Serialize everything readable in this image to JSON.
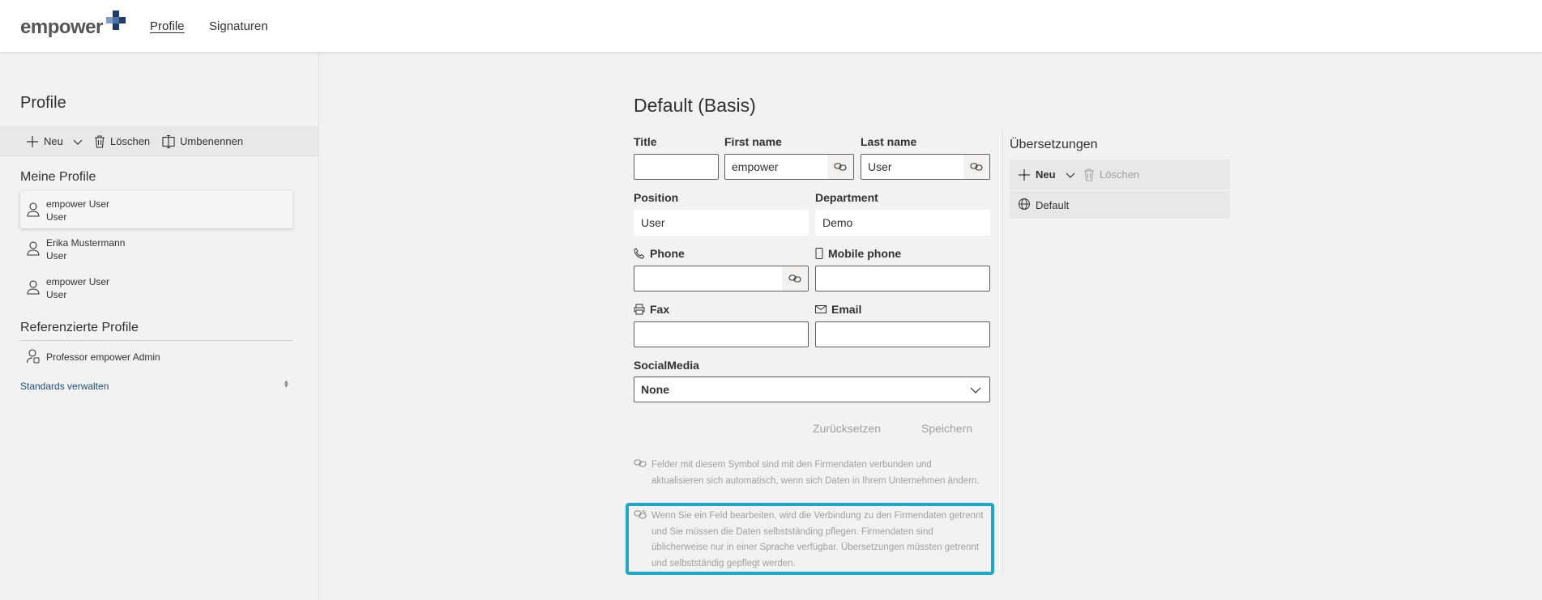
{
  "header": {
    "logo_text": "empower",
    "nav": [
      "Profile",
      "Signaturen"
    ]
  },
  "sidebar": {
    "title": "Profile",
    "toolbar": {
      "new_label": "Neu",
      "delete_label": "Löschen",
      "rename_label": "Umbenennen"
    },
    "my_profiles_title": "Meine Profile",
    "my_profiles": [
      {
        "name": "empower User",
        "role": "User",
        "selected": true
      },
      {
        "name": "Erika Mustermann",
        "role": "User",
        "selected": false
      },
      {
        "name": "empower User",
        "role": "User",
        "selected": false
      }
    ],
    "referenced_title": "Referenzierte Profile",
    "referenced": [
      {
        "name": "Professor empower Admin"
      }
    ],
    "standards_link": "Standards verwalten"
  },
  "form": {
    "title": "Default (Basis)",
    "fields": {
      "title": {
        "label": "Title",
        "value": ""
      },
      "first_name": {
        "label": "First name",
        "value": "empower"
      },
      "last_name": {
        "label": "Last name",
        "value": "User"
      },
      "position": {
        "label": "Position",
        "value": "User"
      },
      "department": {
        "label": "Department",
        "value": "Demo"
      },
      "phone": {
        "label": "Phone",
        "value": ""
      },
      "mobile": {
        "label": "Mobile phone",
        "value": ""
      },
      "fax": {
        "label": "Fax",
        "value": ""
      },
      "email": {
        "label": "Email",
        "value": ""
      },
      "social": {
        "label": "SocialMedia",
        "value": "None"
      }
    },
    "reset_label": "Zurücksetzen",
    "save_label": "Speichern",
    "info_linked": "Felder mit diesem Symbol sind mit den Firmendaten verbunden und aktualisieren sich automatisch, wenn sich Daten in Ihrem Unternehmen ändern.",
    "info_unlinked": "Wenn Sie ein Feld bearbeiten, wird die Verbindung zu den Firmendaten getrennt und Sie müssen die Daten selbstständing pflegen. Firmendaten sind üblicherweise nur in einer Sprache verfügbar. Übersetzungen müssten getrennt und selbstständig gepflegt werden."
  },
  "translations": {
    "title": "Übersetzungen",
    "new_label": "Neu",
    "delete_label": "Löschen",
    "items": [
      "Default"
    ]
  },
  "colors": {
    "highlight": "#1ea7c8",
    "logo_accent": "#1f3a68",
    "link": "#1f4e79"
  }
}
